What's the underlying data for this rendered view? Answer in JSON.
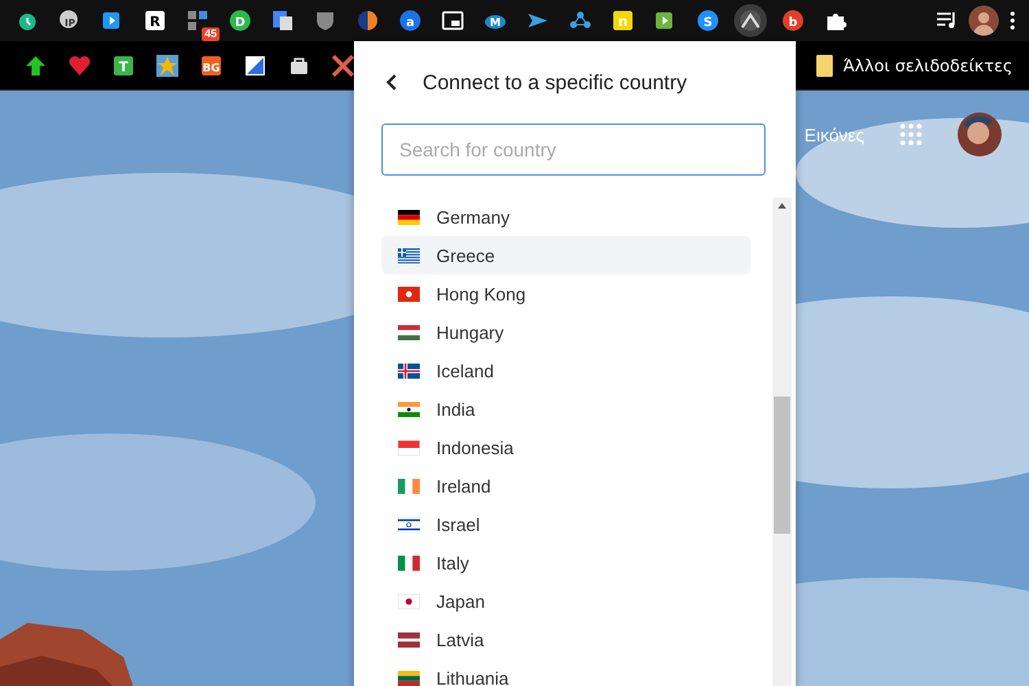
{
  "toolbar": {
    "extensions": [
      {
        "kind": "clock",
        "color": "#1db88a"
      },
      {
        "kind": "ip",
        "color": "#cccccc",
        "label": "IP"
      },
      {
        "kind": "arrow",
        "color": "#2196f3"
      },
      {
        "kind": "letter",
        "color": "#ffffff",
        "label": "R"
      },
      {
        "kind": "badge",
        "color": "#3c8dde",
        "badge": "45"
      },
      {
        "kind": "letter-round",
        "color": "#2db84c",
        "label": "D"
      },
      {
        "kind": "translate",
        "color": "#4285f4"
      },
      {
        "kind": "shield",
        "color": "#888888"
      },
      {
        "kind": "half",
        "color": "#f08020"
      },
      {
        "kind": "letter-round",
        "color": "#1a73e8",
        "label": "a"
      },
      {
        "kind": "window",
        "color": "#ffffff"
      },
      {
        "kind": "cloud",
        "color": "#1e88c8",
        "label": "M"
      },
      {
        "kind": "plane",
        "color": "#3aa0e0"
      },
      {
        "kind": "nodes",
        "color": "#3aa0e0"
      },
      {
        "kind": "letter",
        "color": "#f5d800",
        "label": "n"
      },
      {
        "kind": "arrow",
        "color": "#6cb33f"
      },
      {
        "kind": "letter-round",
        "color": "#1e90ff",
        "label": "S"
      },
      {
        "kind": "vpn",
        "color": "#555555",
        "selected": true
      },
      {
        "kind": "letter-round",
        "color": "#e0402a",
        "label": "b"
      },
      {
        "kind": "puzzle",
        "color": "#ffffff"
      }
    ]
  },
  "bookmarks": {
    "items": [
      {
        "kind": "arrow-up",
        "color": "#22c422"
      },
      {
        "kind": "heart",
        "color": "#e02030"
      },
      {
        "kind": "letter",
        "color": "#3cb44a",
        "label": "T"
      },
      {
        "kind": "star",
        "color": "#f5b800"
      },
      {
        "kind": "letter",
        "color": "#f06020",
        "label": "BG"
      },
      {
        "kind": "flag",
        "color": "#2a6ee0"
      },
      {
        "kind": "bag",
        "color": "#dddddd"
      },
      {
        "kind": "cross",
        "color": "#e0604a"
      }
    ],
    "folder": "Άλλοι σελιδοδείκτες"
  },
  "google": {
    "images_link": "Εικόνες"
  },
  "popup": {
    "title": "Connect to a specific country",
    "search": {
      "placeholder": "Search for country"
    },
    "countries": [
      {
        "name": "Germany",
        "hovered": false
      },
      {
        "name": "Greece",
        "hovered": true
      },
      {
        "name": "Hong Kong",
        "hovered": false
      },
      {
        "name": "Hungary",
        "hovered": false
      },
      {
        "name": "Iceland",
        "hovered": false
      },
      {
        "name": "India",
        "hovered": false
      },
      {
        "name": "Indonesia",
        "hovered": false
      },
      {
        "name": "Ireland",
        "hovered": false
      },
      {
        "name": "Israel",
        "hovered": false
      },
      {
        "name": "Italy",
        "hovered": false
      },
      {
        "name": "Japan",
        "hovered": false
      },
      {
        "name": "Latvia",
        "hovered": false
      },
      {
        "name": "Lithuania",
        "hovered": false
      }
    ]
  }
}
